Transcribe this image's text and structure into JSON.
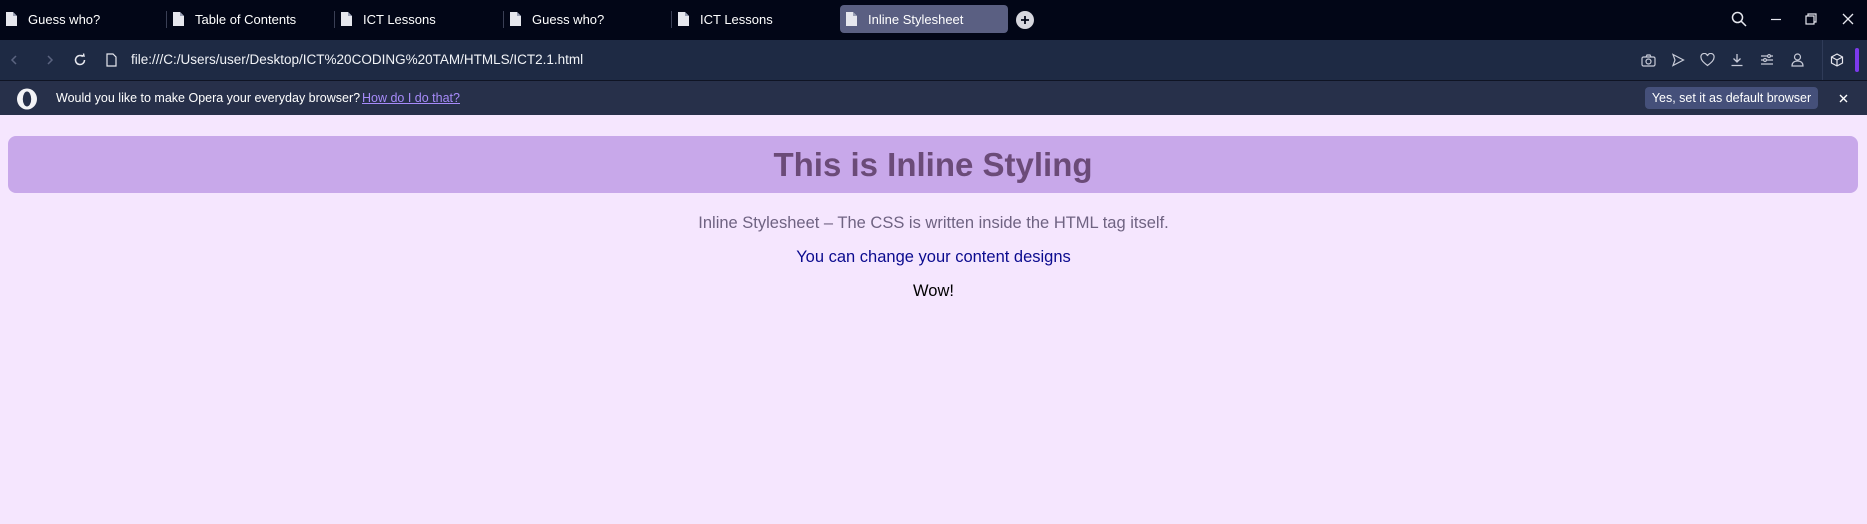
{
  "tabs": [
    {
      "title": "Guess who?"
    },
    {
      "title": "Table of Contents"
    },
    {
      "title": "ICT Lessons"
    },
    {
      "title": "Guess who?"
    },
    {
      "title": "ICT Lessons"
    },
    {
      "title": "Inline Stylesheet",
      "active": true
    }
  ],
  "toolbar": {
    "url": "file:///C:/Users/user/Desktop/ICT%20CODING%20TAM/HTMLS/ICT2.1.html",
    "icons": [
      "back-icon",
      "forward-icon",
      "reload-icon",
      "page-info-icon",
      "snapshot-icon",
      "flow-icon",
      "heart-icon",
      "download-icon",
      "easy-setup-icon",
      "profile-icon",
      "extensions-icon"
    ]
  },
  "window_controls": [
    "search-tabs-icon",
    "minimize-icon",
    "restore-icon",
    "close-icon"
  ],
  "infobar": {
    "message": "Would you like to make Opera your everyday browser?",
    "link": "How do I do that?",
    "button": "Yes, set it as default browser"
  },
  "page": {
    "heading": "This is Inline Styling",
    "paragraph1": "Inline Stylesheet – The CSS is written inside the HTML tag itself.",
    "paragraph2": "You can change your content designs",
    "paragraph3": "Wow!"
  },
  "colors": {
    "page_background": "#f5e6fe",
    "heading_banner": "#c8a8ea",
    "heading_text": "#6b4b78",
    "paragraph1_text": "#6f6382",
    "paragraph2_text": "#0b0b8f",
    "paragraph3_text": "#000000",
    "browser_chrome": "#020617",
    "accent": "#7c3aed"
  }
}
